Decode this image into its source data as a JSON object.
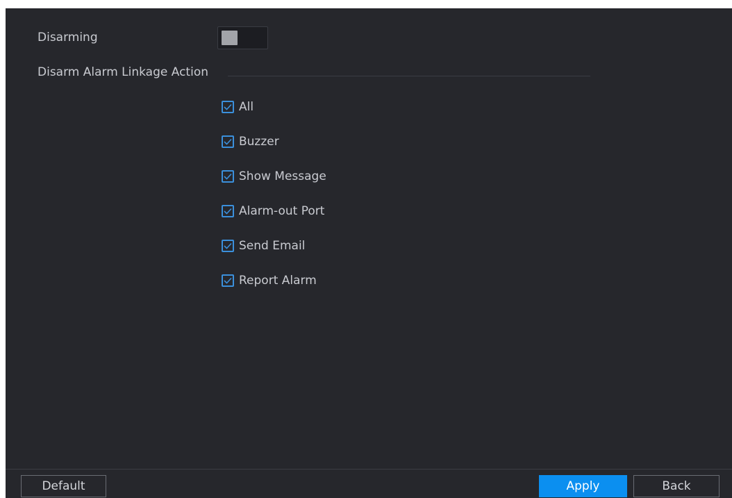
{
  "disarming": {
    "label": "Disarming",
    "enabled": false
  },
  "linkage": {
    "section_title": "Disarm Alarm Linkage Action",
    "options": [
      {
        "label": "All",
        "checked": true
      },
      {
        "label": "Buzzer",
        "checked": true
      },
      {
        "label": "Show Message",
        "checked": true
      },
      {
        "label": "Alarm-out Port",
        "checked": true
      },
      {
        "label": "Send Email",
        "checked": true
      },
      {
        "label": "Report Alarm",
        "checked": true
      }
    ]
  },
  "footer": {
    "default_label": "Default",
    "apply_label": "Apply",
    "back_label": "Back"
  },
  "colors": {
    "background": "#26272c",
    "accent": "#0b8ff0",
    "checkbox": "#3b90dc"
  }
}
